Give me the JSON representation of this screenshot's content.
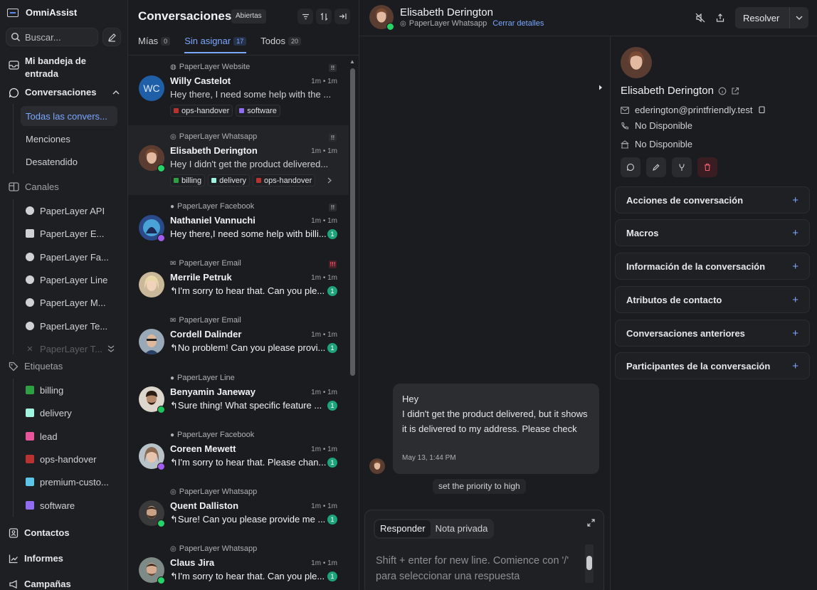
{
  "app": {
    "name": "OmniAssist"
  },
  "sidebar": {
    "search_placeholder": "Buscar...",
    "inbox_label": "Mi bandeja de entrada",
    "conversations_label": "Conversaciones",
    "conversation_views": [
      "Todas las convers...",
      "Menciones",
      "Desatendido"
    ],
    "channels_label": "Canales",
    "channels": [
      "PaperLayer API",
      "PaperLayer E...",
      "PaperLayer Fa...",
      "PaperLayer Line",
      "PaperLayer M...",
      "PaperLayer Te...",
      "PaperLayer T..."
    ],
    "labels_label": "Etiquetas",
    "labels": [
      {
        "name": "billing",
        "color": "#2ea043"
      },
      {
        "name": "delivery",
        "color": "#9ff5e0"
      },
      {
        "name": "lead",
        "color": "#e8559a"
      },
      {
        "name": "ops-handover",
        "color": "#b8322f"
      },
      {
        "name": "premium-custo...",
        "color": "#5bc6e8"
      },
      {
        "name": "software",
        "color": "#8f6cf0"
      }
    ],
    "contacts_label": "Contactos",
    "reports_label": "Informes",
    "campaigns_label": "Campañas"
  },
  "conv_list": {
    "title": "Conversaciones",
    "status": "Abiertas",
    "tabs": [
      {
        "label": "Mías",
        "count": "0"
      },
      {
        "label": "Sin asignar",
        "count": "17"
      },
      {
        "label": "Todos",
        "count": "20"
      }
    ],
    "items": [
      {
        "inbox": "PaperLayer Website",
        "name": "Willy Castelot",
        "time": "1m • 1m",
        "message": "Hey there, I need some help with the ...",
        "initials": "WC",
        "tags": [
          "ops-handover",
          "software"
        ]
      },
      {
        "inbox": "PaperLayer Whatsapp",
        "name": "Elisabeth Derington",
        "time": "1m • 1m",
        "message": "Hey I didn't get the product delivered...",
        "tags": [
          "billing",
          "delivery",
          "ops-handover"
        ]
      },
      {
        "inbox": "PaperLayer Facebook",
        "name": "Nathaniel Vannuchi",
        "time": "1m • 1m",
        "message": "Hey there,I need some help with billi...",
        "unread": "1"
      },
      {
        "inbox": "PaperLayer Email",
        "name": "Merrile Petruk",
        "time": "1m • 1m",
        "message": "I'm sorry to hear that. Can you ple...",
        "unread": "1"
      },
      {
        "inbox": "PaperLayer Email",
        "name": "Cordell Dalinder",
        "time": "1m • 1m",
        "message": "No problem! Can you please provi...",
        "unread": "1"
      },
      {
        "inbox": "PaperLayer Line",
        "name": "Benyamin Janeway",
        "time": "1m • 1m",
        "message": "Sure thing! What specific feature ...",
        "unread": "1"
      },
      {
        "inbox": "PaperLayer Facebook",
        "name": "Coreen Mewett",
        "time": "1m • 1m",
        "message": "I'm sorry to hear that. Please chan...",
        "unread": "1"
      },
      {
        "inbox": "PaperLayer Whatsapp",
        "name": "Quent Dalliston",
        "time": "1m • 1m",
        "message": "Sure! Can you please provide me ...",
        "unread": "1"
      },
      {
        "inbox": "PaperLayer Whatsapp",
        "name": "Claus Jira",
        "time": "1m • 1m",
        "message": "I'm sorry to hear that. Can you ple...",
        "unread": "1"
      }
    ]
  },
  "chat": {
    "contact_name": "Elisabeth Derington",
    "inbox": "PaperLayer Whatsapp",
    "close_details": "Cerrar detalles",
    "resolve_label": "Resolver",
    "message_line1": "Hey",
    "message_body": "I didn't get the product delivered, but it shows it is delivered to my address. Please check",
    "message_time": "May 13, 1:44 PM",
    "activity": "set the priority to high",
    "reply_tab": "Responder",
    "private_tab": "Nota privada",
    "reply_placeholder": "Shift + enter for new line. Comience con '/' para seleccionar una respuesta"
  },
  "contact_panel": {
    "name": "Elisabeth Derington",
    "email": "ederington@printfriendly.test",
    "phone": "No Disponible",
    "company": "No Disponible",
    "sections": [
      "Acciones de conversación",
      "Macros",
      "Información de la conversación",
      "Atributos de contacto",
      "Conversaciones anteriores",
      "Participantes de la conversación"
    ]
  }
}
